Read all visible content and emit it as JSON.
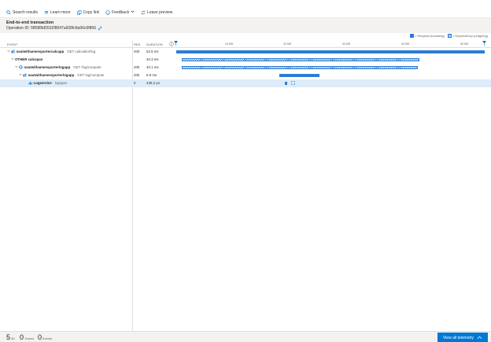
{
  "toolbar": {
    "search": "Search results",
    "learn": "Learn more",
    "copy": "Copy link",
    "feedback": "Feedback",
    "leave": "Leave preview"
  },
  "header": {
    "title": "End-to-end transaction",
    "operation_label": "Operation ID: 5f8989d5532f8047a928fc8a96c6f866"
  },
  "legend": {
    "request": "= Request (incoming)",
    "dependency": "= Dependency (outgoing)"
  },
  "grid": {
    "col_event": "EVENT",
    "col_res": "RES.",
    "col_duration": "DURATION",
    "ticks": [
      "10 MS",
      "20 MS",
      "30 MS",
      "40 MS",
      "50 MS"
    ],
    "rows": [
      {
        "name": "nautwithameexportercalcapp",
        "op": "GET calculator/log",
        "res": "200",
        "duration": "52.5 ms",
        "bar_start_ms": 0,
        "bar_dur_ms": 52.5
      },
      {
        "name": "OTHER calcspan",
        "op": "",
        "res": "",
        "duration": "40.3 ms",
        "bar_start_ms": 1,
        "bar_dur_ms": 40.3
      },
      {
        "name": "nautwithameexporterlogapp",
        "op": "GET /log/compute",
        "res": "200",
        "duration": "40.1 ms",
        "bar_start_ms": 1,
        "bar_dur_ms": 40.1
      },
      {
        "name": "nautwithameexporterlogapp",
        "op": "GET log/compute",
        "res": "200",
        "duration": "6.9 ms",
        "bar_start_ms": 17.5,
        "bar_dur_ms": 6.9
      },
      {
        "name": "Logservice",
        "op": "logspan",
        "res": "0",
        "duration": "439.2 μs",
        "bar_start_ms": 18.5,
        "bar_dur_ms": 0.44
      }
    ]
  },
  "footer": {
    "all_count": "5",
    "all_label": "All",
    "traces_count": "0",
    "traces_label": "Traces",
    "events_count": "0",
    "events_label": "Events",
    "view_all": "View all telemetry"
  },
  "colors": {
    "accent": "#0078d4",
    "bar": "#2b7cd3",
    "selected_row": "#deecf9"
  }
}
